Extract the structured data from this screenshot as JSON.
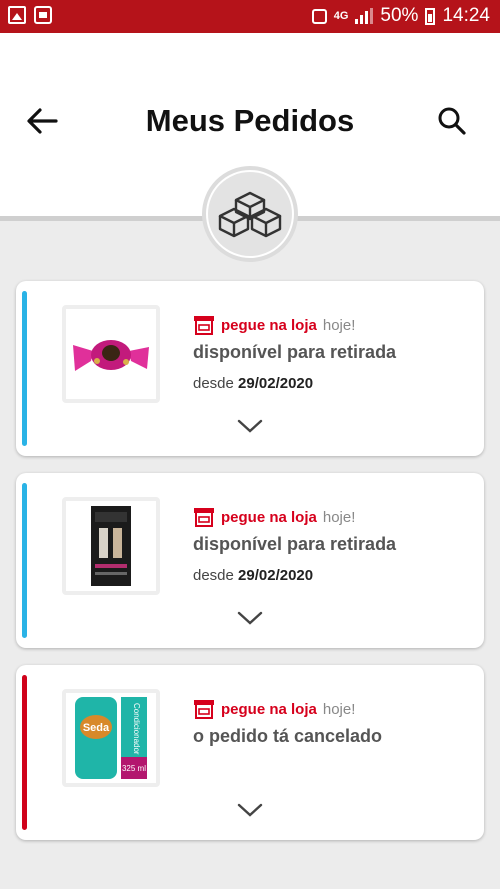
{
  "status_bar": {
    "network": "4G",
    "battery": "50%",
    "time": "14:24"
  },
  "header": {
    "title": "Meus Pedidos"
  },
  "colors": {
    "brand_red": "#b5131a",
    "accent_red": "#d6001c",
    "available": "#2ab3e6",
    "cancelled": "#d0021b"
  },
  "orders": [
    {
      "pickup_label": "pegue na loja",
      "pickup_when": "hoje!",
      "status": "disponível para retirada",
      "since_prefix": "desde",
      "since_date": "29/02/2020",
      "product_icon": "candy-icon"
    },
    {
      "pickup_label": "pegue na loja",
      "pickup_when": "hoje!",
      "status": "disponível para retirada",
      "since_prefix": "desde",
      "since_date": "29/02/2020",
      "product_icon": "shampoo-box-icon"
    },
    {
      "pickup_label": "pegue na loja",
      "pickup_when": "hoje!",
      "status": "o pedido tá cancelado",
      "product_icon": "conditioner-bottle-icon",
      "product_text": {
        "brand": "Seda",
        "label": "Condicionador",
        "volume": "325 ml"
      }
    }
  ]
}
